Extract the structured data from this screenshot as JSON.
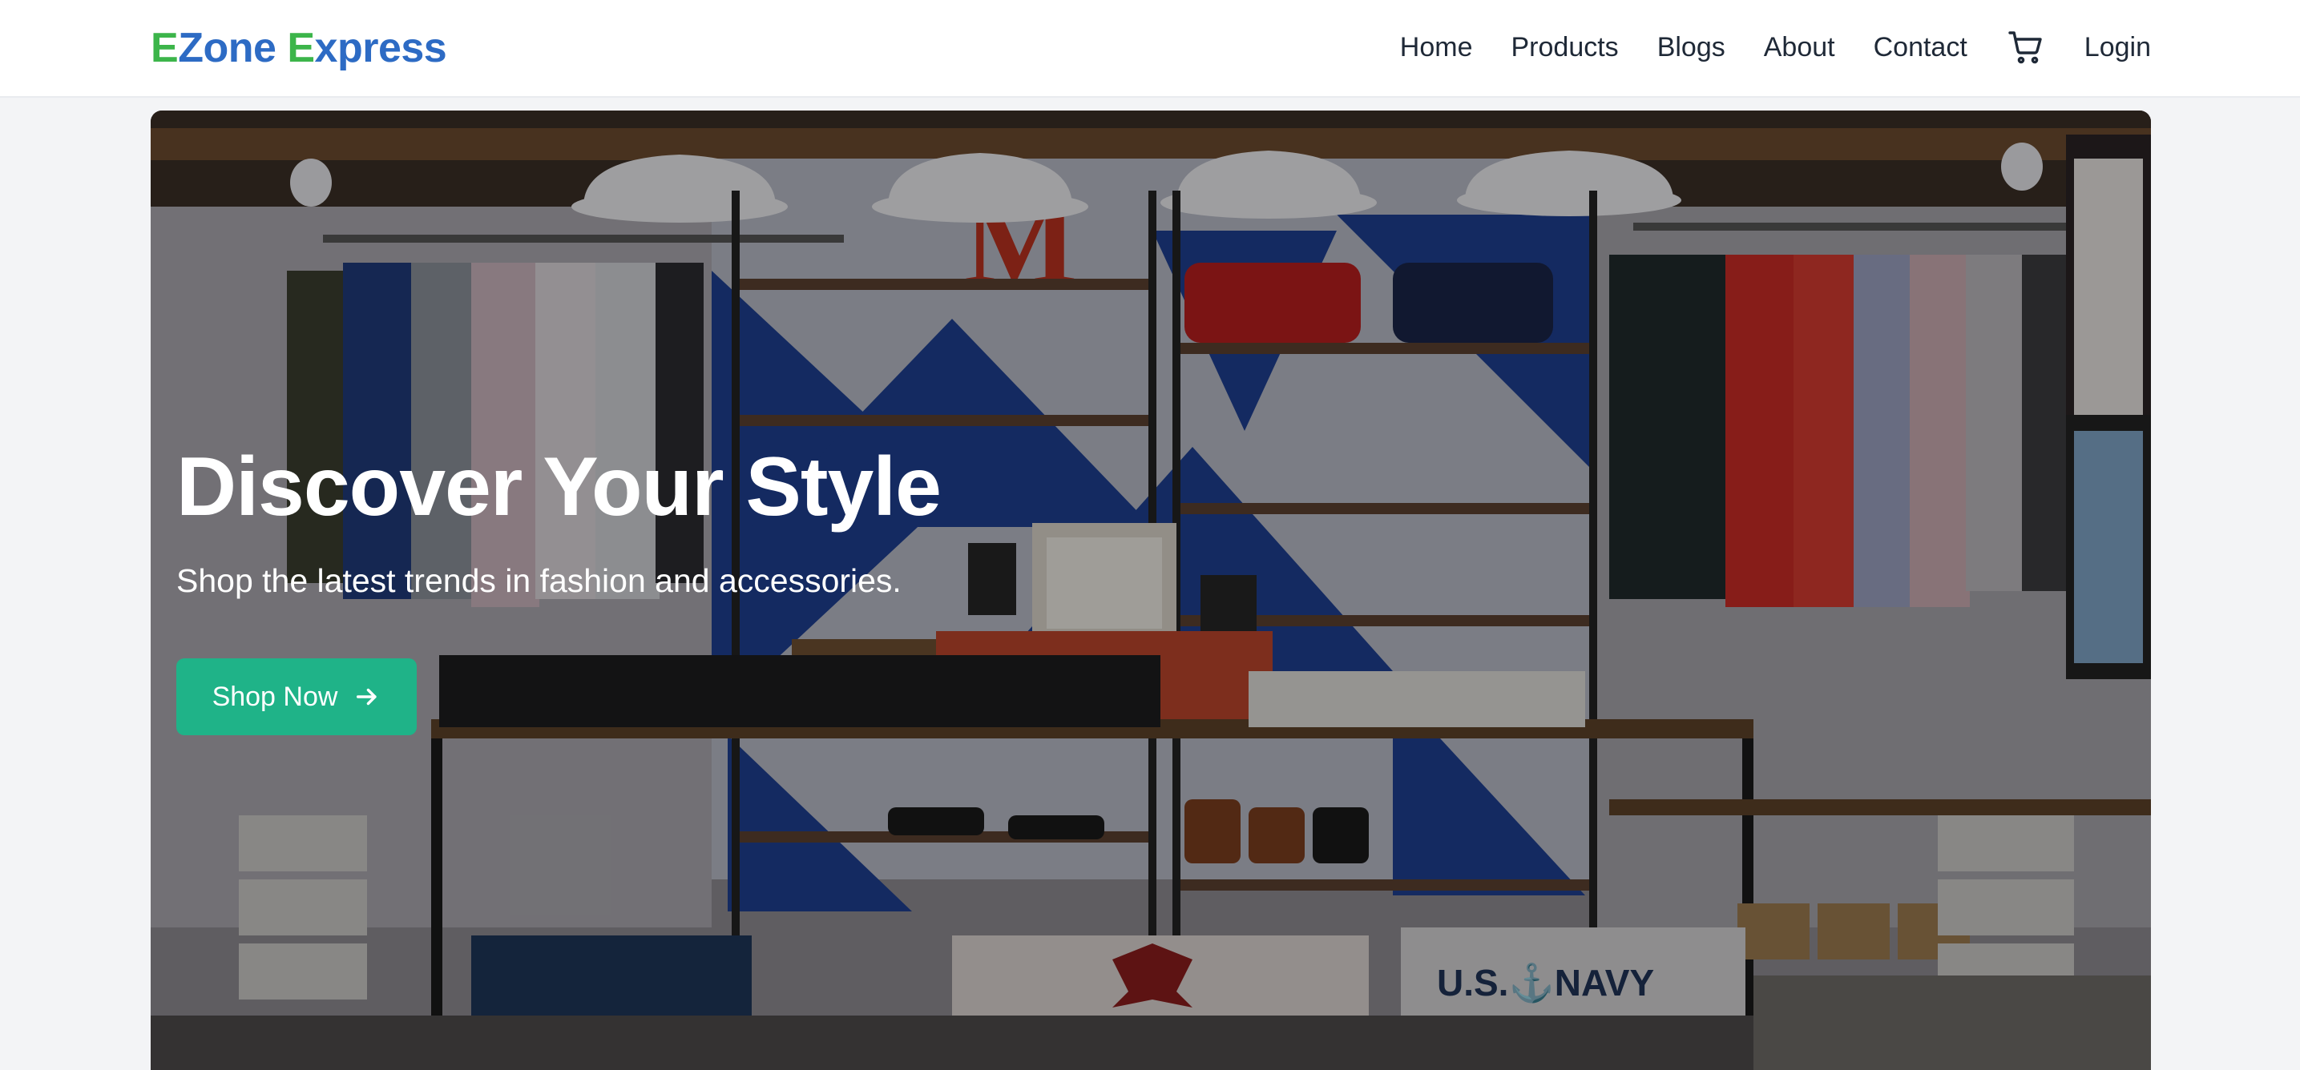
{
  "brand": {
    "letter1": "E",
    "word1": "Zone ",
    "letter2": "E",
    "word2": "xpress",
    "primary_color": "#2d6bc4",
    "accent_color": "#3cb54a"
  },
  "nav": {
    "items": [
      {
        "label": "Home"
      },
      {
        "label": "Products"
      },
      {
        "label": "Blogs"
      },
      {
        "label": "About"
      },
      {
        "label": "Contact"
      }
    ],
    "cart_icon": "shopping-cart-icon",
    "login_label": "Login"
  },
  "hero": {
    "title": "Discover Your Style",
    "subtitle": "Shop the latest trends in fashion and accessories.",
    "cta_label": "Shop Now",
    "cta_icon": "arrow-right-icon",
    "cta_color": "#1fb388",
    "background": "clothing-store-interior-photo"
  }
}
